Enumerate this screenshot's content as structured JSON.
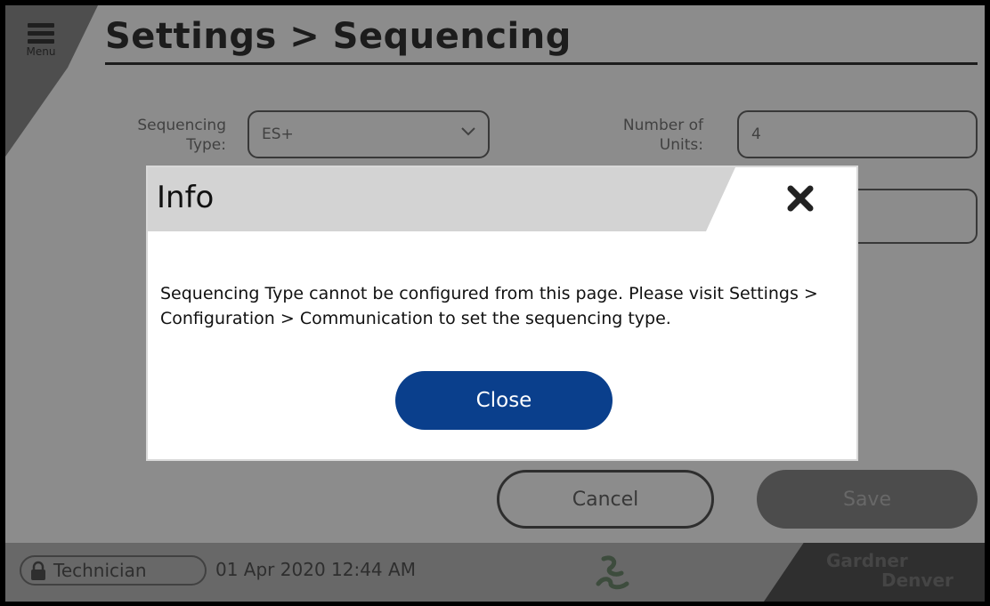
{
  "header": {
    "menu_label": "Menu",
    "title": "Settings > Sequencing"
  },
  "form": {
    "sequencing_type_label_line1": "Sequencing",
    "sequencing_type_label_line2": "Type:",
    "sequencing_type_value": "ES+",
    "number_of_units_label_line1": "Number of",
    "number_of_units_label_line2": "Units:",
    "number_of_units_value": "4"
  },
  "actions": {
    "cancel_label": "Cancel",
    "save_label": "Save"
  },
  "footer": {
    "user_role": "Technician",
    "datetime": "01 Apr 2020 12:44 AM",
    "brand_line1": "Gardner",
    "brand_line2": "Denver"
  },
  "dialog": {
    "title": "Info",
    "message_line1": "Sequencing Type cannot be configured from this page. Please visit Settings >",
    "message_line2": "Configuration > Communication to set the sequencing type.",
    "close_button_label": "Close"
  },
  "icons": {
    "menu": "hamburger-icon",
    "chevron": "chevron-down-icon",
    "close": "close-x-icon",
    "lock": "lock-icon",
    "logo": "logo-swirl-icon"
  },
  "colors": {
    "primary_button": "#0a3f8c",
    "dialog_header": "#d3d3d3",
    "overlay": "rgba(0,0,0,0.45)"
  }
}
